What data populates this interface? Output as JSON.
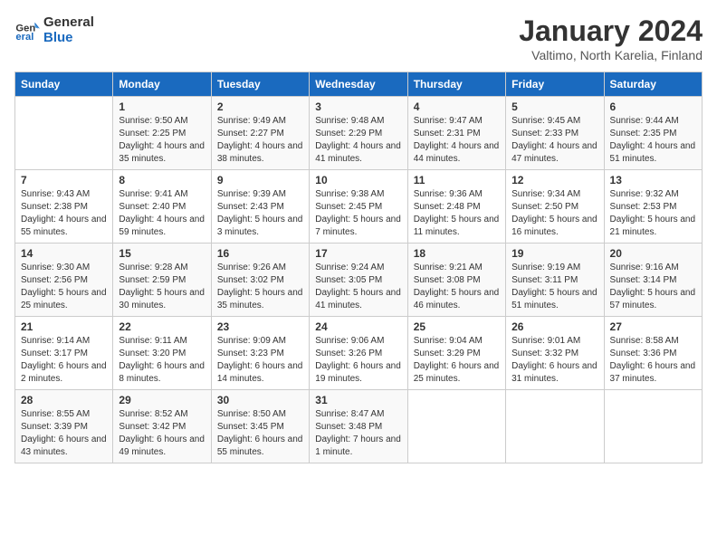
{
  "header": {
    "logo_line1": "General",
    "logo_line2": "Blue",
    "month": "January 2024",
    "location": "Valtimo, North Karelia, Finland"
  },
  "weekdays": [
    "Sunday",
    "Monday",
    "Tuesday",
    "Wednesday",
    "Thursday",
    "Friday",
    "Saturday"
  ],
  "weeks": [
    [
      {
        "day": "",
        "sunrise": "",
        "sunset": "",
        "daylight": ""
      },
      {
        "day": "1",
        "sunrise": "Sunrise: 9:50 AM",
        "sunset": "Sunset: 2:25 PM",
        "daylight": "Daylight: 4 hours and 35 minutes."
      },
      {
        "day": "2",
        "sunrise": "Sunrise: 9:49 AM",
        "sunset": "Sunset: 2:27 PM",
        "daylight": "Daylight: 4 hours and 38 minutes."
      },
      {
        "day": "3",
        "sunrise": "Sunrise: 9:48 AM",
        "sunset": "Sunset: 2:29 PM",
        "daylight": "Daylight: 4 hours and 41 minutes."
      },
      {
        "day": "4",
        "sunrise": "Sunrise: 9:47 AM",
        "sunset": "Sunset: 2:31 PM",
        "daylight": "Daylight: 4 hours and 44 minutes."
      },
      {
        "day": "5",
        "sunrise": "Sunrise: 9:45 AM",
        "sunset": "Sunset: 2:33 PM",
        "daylight": "Daylight: 4 hours and 47 minutes."
      },
      {
        "day": "6",
        "sunrise": "Sunrise: 9:44 AM",
        "sunset": "Sunset: 2:35 PM",
        "daylight": "Daylight: 4 hours and 51 minutes."
      }
    ],
    [
      {
        "day": "7",
        "sunrise": "Sunrise: 9:43 AM",
        "sunset": "Sunset: 2:38 PM",
        "daylight": "Daylight: 4 hours and 55 minutes."
      },
      {
        "day": "8",
        "sunrise": "Sunrise: 9:41 AM",
        "sunset": "Sunset: 2:40 PM",
        "daylight": "Daylight: 4 hours and 59 minutes."
      },
      {
        "day": "9",
        "sunrise": "Sunrise: 9:39 AM",
        "sunset": "Sunset: 2:43 PM",
        "daylight": "Daylight: 5 hours and 3 minutes."
      },
      {
        "day": "10",
        "sunrise": "Sunrise: 9:38 AM",
        "sunset": "Sunset: 2:45 PM",
        "daylight": "Daylight: 5 hours and 7 minutes."
      },
      {
        "day": "11",
        "sunrise": "Sunrise: 9:36 AM",
        "sunset": "Sunset: 2:48 PM",
        "daylight": "Daylight: 5 hours and 11 minutes."
      },
      {
        "day": "12",
        "sunrise": "Sunrise: 9:34 AM",
        "sunset": "Sunset: 2:50 PM",
        "daylight": "Daylight: 5 hours and 16 minutes."
      },
      {
        "day": "13",
        "sunrise": "Sunrise: 9:32 AM",
        "sunset": "Sunset: 2:53 PM",
        "daylight": "Daylight: 5 hours and 21 minutes."
      }
    ],
    [
      {
        "day": "14",
        "sunrise": "Sunrise: 9:30 AM",
        "sunset": "Sunset: 2:56 PM",
        "daylight": "Daylight: 5 hours and 25 minutes."
      },
      {
        "day": "15",
        "sunrise": "Sunrise: 9:28 AM",
        "sunset": "Sunset: 2:59 PM",
        "daylight": "Daylight: 5 hours and 30 minutes."
      },
      {
        "day": "16",
        "sunrise": "Sunrise: 9:26 AM",
        "sunset": "Sunset: 3:02 PM",
        "daylight": "Daylight: 5 hours and 35 minutes."
      },
      {
        "day": "17",
        "sunrise": "Sunrise: 9:24 AM",
        "sunset": "Sunset: 3:05 PM",
        "daylight": "Daylight: 5 hours and 41 minutes."
      },
      {
        "day": "18",
        "sunrise": "Sunrise: 9:21 AM",
        "sunset": "Sunset: 3:08 PM",
        "daylight": "Daylight: 5 hours and 46 minutes."
      },
      {
        "day": "19",
        "sunrise": "Sunrise: 9:19 AM",
        "sunset": "Sunset: 3:11 PM",
        "daylight": "Daylight: 5 hours and 51 minutes."
      },
      {
        "day": "20",
        "sunrise": "Sunrise: 9:16 AM",
        "sunset": "Sunset: 3:14 PM",
        "daylight": "Daylight: 5 hours and 57 minutes."
      }
    ],
    [
      {
        "day": "21",
        "sunrise": "Sunrise: 9:14 AM",
        "sunset": "Sunset: 3:17 PM",
        "daylight": "Daylight: 6 hours and 2 minutes."
      },
      {
        "day": "22",
        "sunrise": "Sunrise: 9:11 AM",
        "sunset": "Sunset: 3:20 PM",
        "daylight": "Daylight: 6 hours and 8 minutes."
      },
      {
        "day": "23",
        "sunrise": "Sunrise: 9:09 AM",
        "sunset": "Sunset: 3:23 PM",
        "daylight": "Daylight: 6 hours and 14 minutes."
      },
      {
        "day": "24",
        "sunrise": "Sunrise: 9:06 AM",
        "sunset": "Sunset: 3:26 PM",
        "daylight": "Daylight: 6 hours and 19 minutes."
      },
      {
        "day": "25",
        "sunrise": "Sunrise: 9:04 AM",
        "sunset": "Sunset: 3:29 PM",
        "daylight": "Daylight: 6 hours and 25 minutes."
      },
      {
        "day": "26",
        "sunrise": "Sunrise: 9:01 AM",
        "sunset": "Sunset: 3:32 PM",
        "daylight": "Daylight: 6 hours and 31 minutes."
      },
      {
        "day": "27",
        "sunrise": "Sunrise: 8:58 AM",
        "sunset": "Sunset: 3:36 PM",
        "daylight": "Daylight: 6 hours and 37 minutes."
      }
    ],
    [
      {
        "day": "28",
        "sunrise": "Sunrise: 8:55 AM",
        "sunset": "Sunset: 3:39 PM",
        "daylight": "Daylight: 6 hours and 43 minutes."
      },
      {
        "day": "29",
        "sunrise": "Sunrise: 8:52 AM",
        "sunset": "Sunset: 3:42 PM",
        "daylight": "Daylight: 6 hours and 49 minutes."
      },
      {
        "day": "30",
        "sunrise": "Sunrise: 8:50 AM",
        "sunset": "Sunset: 3:45 PM",
        "daylight": "Daylight: 6 hours and 55 minutes."
      },
      {
        "day": "31",
        "sunrise": "Sunrise: 8:47 AM",
        "sunset": "Sunset: 3:48 PM",
        "daylight": "Daylight: 7 hours and 1 minute."
      },
      {
        "day": "",
        "sunrise": "",
        "sunset": "",
        "daylight": ""
      },
      {
        "day": "",
        "sunrise": "",
        "sunset": "",
        "daylight": ""
      },
      {
        "day": "",
        "sunrise": "",
        "sunset": "",
        "daylight": ""
      }
    ]
  ]
}
